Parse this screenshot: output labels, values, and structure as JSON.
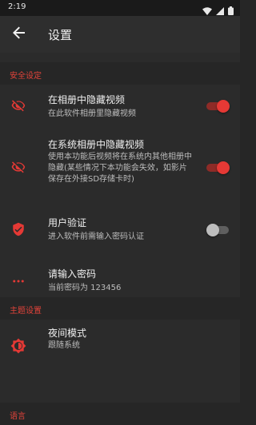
{
  "status_bar": {
    "time": "2:19"
  },
  "app_bar": {
    "title": "设置"
  },
  "sections": {
    "security": "安全设定",
    "theme": "主题设置",
    "language": "语言"
  },
  "settings": {
    "hide_in_app_album": {
      "title": "在相册中隐藏视频",
      "subtitle": "在此软件相册里隐藏视频",
      "enabled": true
    },
    "hide_in_system_album": {
      "title": "在系统相册中隐藏视频",
      "subtitle": "使用本功能后视频将在系统内其他相册中隐藏(某些情况下本功能会失效，如影片保存在外接SD存储卡时)",
      "enabled": true
    },
    "user_verification": {
      "title": "用户验证",
      "subtitle": "进入软件前需输入密码认证",
      "enabled": false
    },
    "password": {
      "title": "请输入密码",
      "subtitle": "当前密码为 123456"
    },
    "night_mode": {
      "title": "夜间模式",
      "subtitle": "跟随系统"
    }
  },
  "colors": {
    "accent": "#e53935",
    "section_text": "#e2433a",
    "background": "#2b2b2b"
  }
}
